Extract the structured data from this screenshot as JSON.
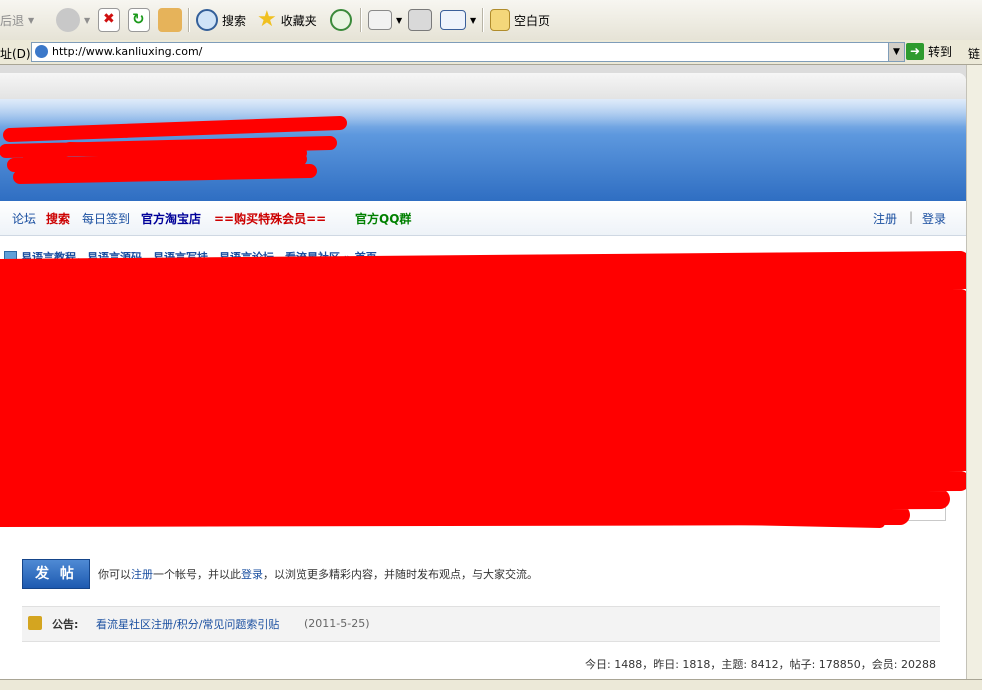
{
  "toolbar": {
    "back_label": "后退",
    "search_label": "搜索",
    "favorites_label": "收藏夹",
    "blank_page_label": "空白页"
  },
  "address": {
    "label": "址(D)",
    "url": "http://www.kanliuxing.com/",
    "go_label": "转到",
    "links_label": "链"
  },
  "nav": {
    "items": [
      "论坛",
      "搜索",
      "每日签到",
      "官方淘宝店",
      "==购买特殊会员==",
      "官方QQ群"
    ],
    "register": "注册",
    "divider": "|",
    "login": "登录"
  },
  "colors": {
    "nav_forum": "#1a4fa0",
    "nav_search": "#cc0000",
    "nav_checkin": "#1a4fa0",
    "nav_shop": "#000099",
    "nav_vip": "#cc0000",
    "nav_qq": "#008000",
    "scribble": "#ff0000"
  },
  "breadcrumb": "易语言教程，易语言源码，易语言写挂，易语言论坛，看流星社区 » 首页",
  "post": {
    "button": "发 帖",
    "note_before": "你可以",
    "register_link": "注册",
    "note_mid": "一个帐号，并以此",
    "login_link": "登录",
    "note_after": "，以浏览更多精彩内容，并随时发布观点，与大家交流。"
  },
  "notice": {
    "label": "公告:",
    "link": "看流星社区注册/积分/常见问题索引贴",
    "date": "(2011-5-25)"
  },
  "stats": "今日: 1488，昨日: 1818，主题: 8412，帖子: 178850，会员: 20288"
}
